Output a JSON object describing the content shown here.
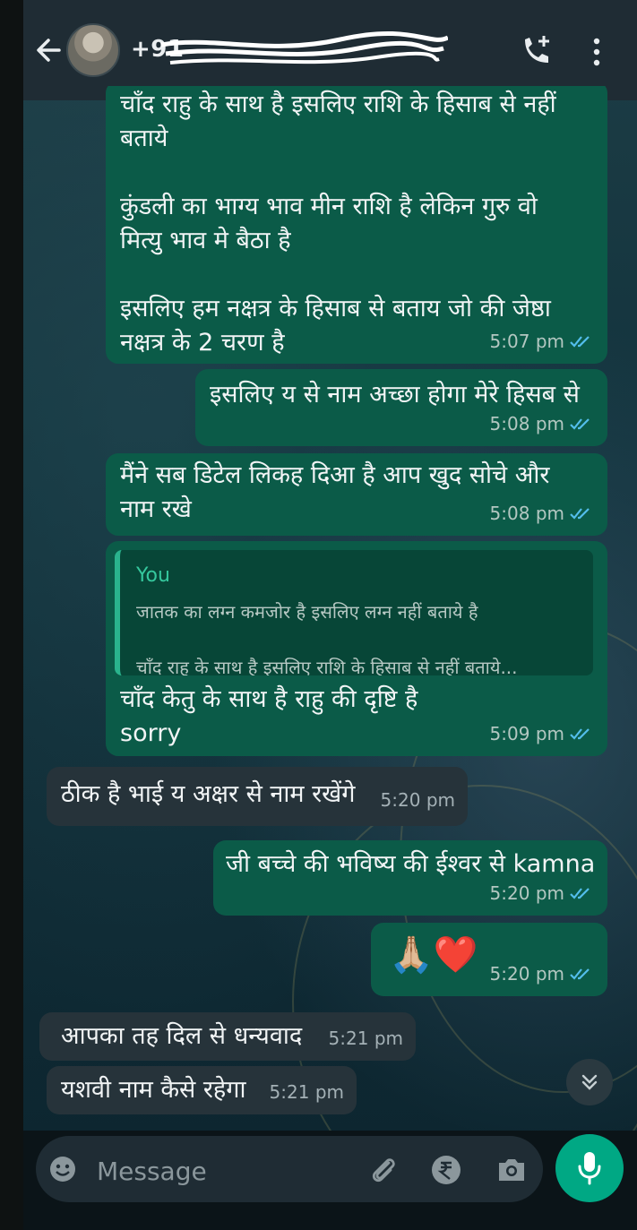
{
  "header": {
    "contact_name": "+91",
    "icons": {
      "back": "back-arrow-icon",
      "call": "add-call-icon",
      "more": "more-vert-icon"
    }
  },
  "messages": [
    {
      "direction": "out",
      "lines": "चाँद राहु के साथ है इसलिए राशि के हिसाब से नहीं\nबताये\n\nकुंडली का भाग्य भाव मीन राशि है लेकिन गुरु वो\nमित्यु भाव मे बैठा है\n\nइसलिए हम नक्षत्र के हिसाब  से बताय जो की जेष्ठा\nनक्षत्र के 2 चरण है",
      "time": "5:07 pm"
    },
    {
      "direction": "out",
      "lines": "इसलिए य से नाम अच्छा होगा मेरे हिसब से",
      "time": "5:08 pm"
    },
    {
      "direction": "out",
      "lines": "मैंने सब डिटेल लिकह दिआ है आप खुद सोचे और\nनाम रखे",
      "time": "5:08 pm"
    },
    {
      "direction": "out",
      "quote": {
        "author": "You",
        "line1": "जातक का लग्न कमजोर है इसलिए लग्न नहीं बताये है",
        "line2": "चाँद राहु के साथ है इसलिए राशि के हिसाब से नहीं बताये..."
      },
      "lines": "चाँद केतु के साथ है राहु की दृष्टि है\nsorry",
      "time": "5:09 pm"
    },
    {
      "direction": "in",
      "lines": "ठीक है भाई य अक्षर से नाम रखेंगे",
      "time": "5:20 pm"
    },
    {
      "direction": "out",
      "lines": "जी बच्चे की भविष्य की ईश्वर से kamna",
      "time": "5:20 pm"
    },
    {
      "direction": "out",
      "lines": "🙏🏼❤️",
      "time": "5:20 pm"
    },
    {
      "direction": "in",
      "lines": "आपका तह दिल से धन्यवाद",
      "time": "5:21 pm"
    },
    {
      "direction": "in",
      "lines": "यशवी नाम कैसे रहेगा",
      "time": "5:21 pm"
    }
  ],
  "composer": {
    "placeholder": "Message",
    "icons": {
      "emoji": "emoji-icon",
      "attach": "attach-icon",
      "payment": "rupee-icon",
      "camera": "camera-icon",
      "mic": "mic-icon"
    }
  },
  "colors": {
    "outgoing": "#0b5b48",
    "incoming": "#26333a",
    "accent": "#00a884",
    "read_ticks": "#53bdeb"
  }
}
